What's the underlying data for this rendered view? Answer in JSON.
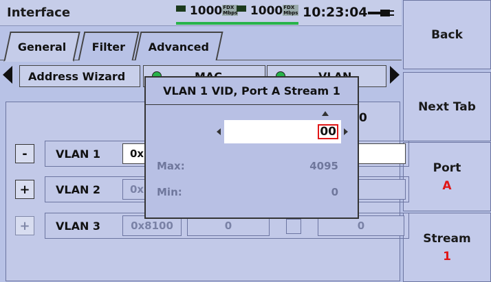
{
  "header": {
    "title": "Interface",
    "port1_speed": "1000",
    "port1_duplex": "FDX",
    "port1_unit": "Mbps",
    "port2_speed": "1000",
    "port2_duplex": "FDX",
    "port2_unit": "Mbps",
    "time": "10:23:04",
    "link_color": "#27b34a"
  },
  "softkeys": {
    "back": "Back",
    "next_tab": "Next Tab",
    "port_label": "Port",
    "port_value": "A",
    "stream_label": "Stream",
    "stream_value": "1"
  },
  "tabs": [
    "General",
    "Filter",
    "Advanced"
  ],
  "active_tab": "General",
  "wizard": {
    "address_wizard": "Address Wizard",
    "mac_label": "MAC",
    "vlan_label": "VLAN"
  },
  "bg_digit": "0",
  "vlan_rows": [
    {
      "toggle": "-",
      "label": "VLAN 1",
      "tpid": "0x",
      "enabled": true
    },
    {
      "toggle": "+",
      "label": "VLAN 2",
      "tpid": "0x",
      "enabled": false
    },
    {
      "toggle": "+",
      "label": "VLAN 3",
      "tpid": "0x8100",
      "priority": "0",
      "vid": "0",
      "enabled": false
    }
  ],
  "popup": {
    "title": "VLAN 1 VID, Port A Stream 1",
    "value": "00",
    "max_label": "Max:",
    "max_value": "4095",
    "min_label": "Min:",
    "min_value": "0"
  },
  "colors": {
    "accent_red": "#e01616",
    "background": "#b8c2e6"
  }
}
